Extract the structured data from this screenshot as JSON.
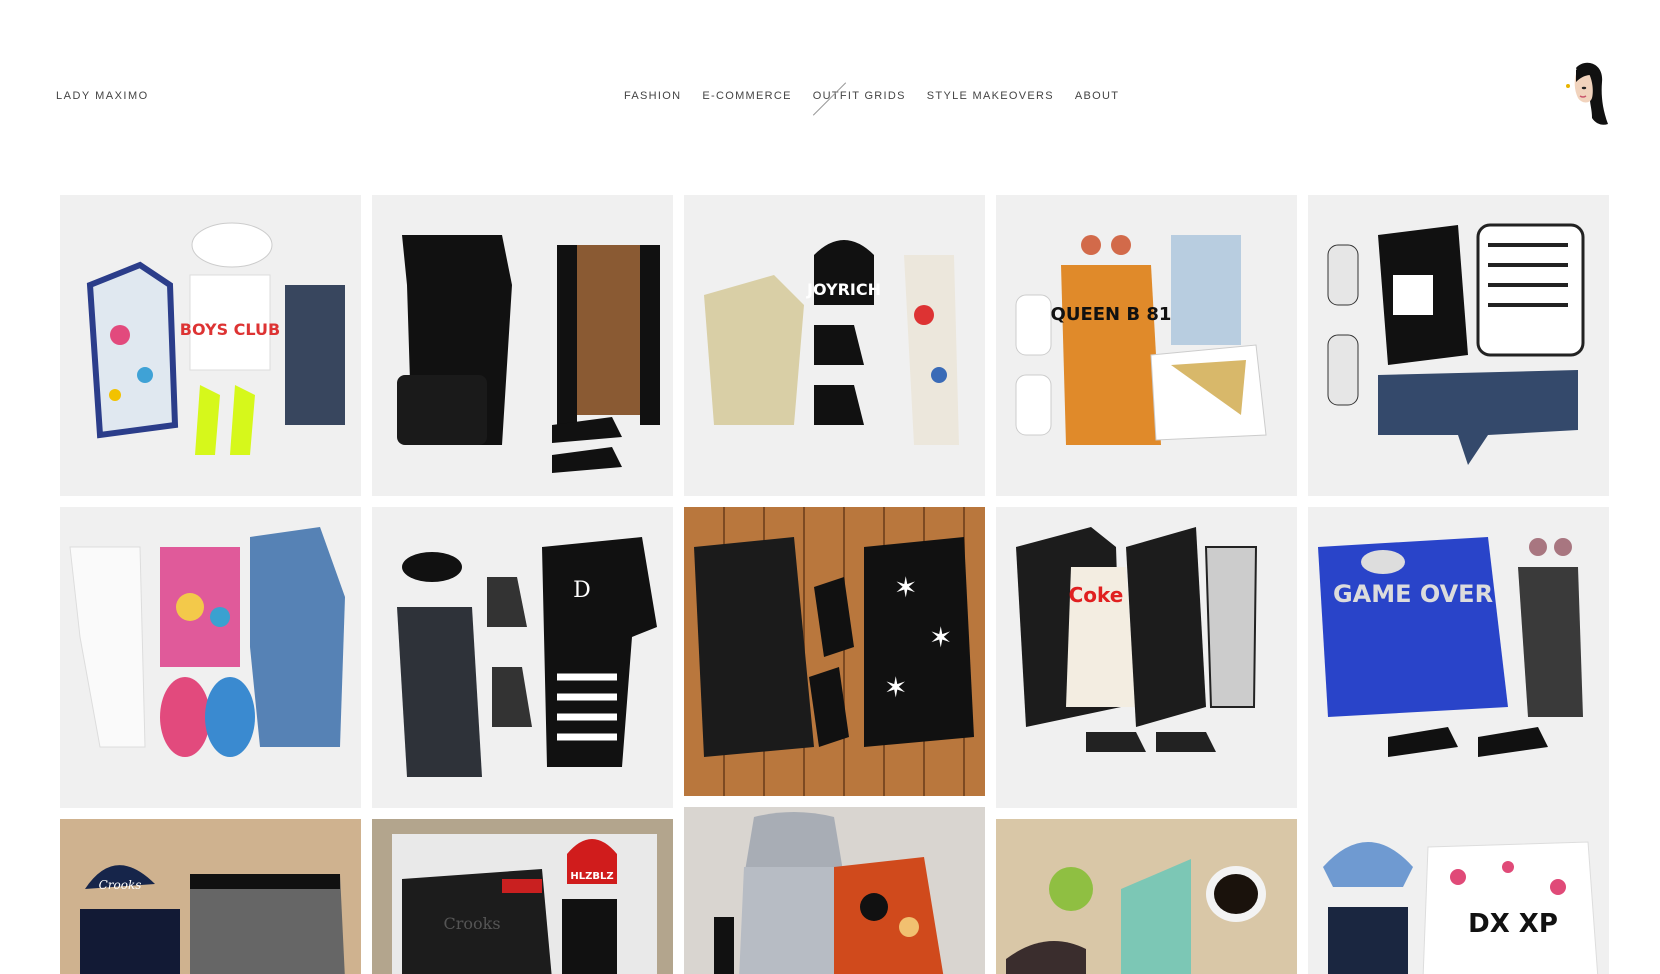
{
  "header": {
    "brand": "LADY MAXIMO",
    "nav": [
      {
        "label": "FASHION",
        "active": false
      },
      {
        "label": "E-COMMERCE",
        "active": false
      },
      {
        "label": "OUTFIT GRIDS",
        "active": true
      },
      {
        "label": "STYLE MAKEOVERS",
        "active": false
      },
      {
        "label": "ABOUT",
        "active": false
      }
    ]
  },
  "grid": {
    "tiles": [
      {
        "text": "BOYS CLUB",
        "bg": "#f0f0f0"
      },
      {
        "text": "",
        "bg": "#f0f0f0"
      },
      {
        "text": "JOYRICH",
        "bg": "#f0f0f0"
      },
      {
        "text": "QUEEN B 81",
        "bg": "#f0f0f0"
      },
      {
        "text": "",
        "bg": "#f0f0f0"
      },
      {
        "text": "",
        "bg": "#f0f0f0"
      },
      {
        "text": "D",
        "bg": "#f0f0f0"
      },
      {
        "text": "",
        "bg": "#b9773d"
      },
      {
        "text": "Coke",
        "bg": "#f0f0f0"
      },
      {
        "text": "GAME OVER",
        "bg": "#f0f0f0"
      },
      {
        "text": "Crooks",
        "bg": "#cfb28f"
      },
      {
        "text": "HLZBLZ",
        "bg": "#b3a58d"
      },
      {
        "text": "",
        "bg": "#d9d5d0"
      },
      {
        "text": "",
        "bg": "#d9c7a7"
      },
      {
        "text": "DX XP",
        "bg": "#f0f0f0"
      }
    ]
  }
}
